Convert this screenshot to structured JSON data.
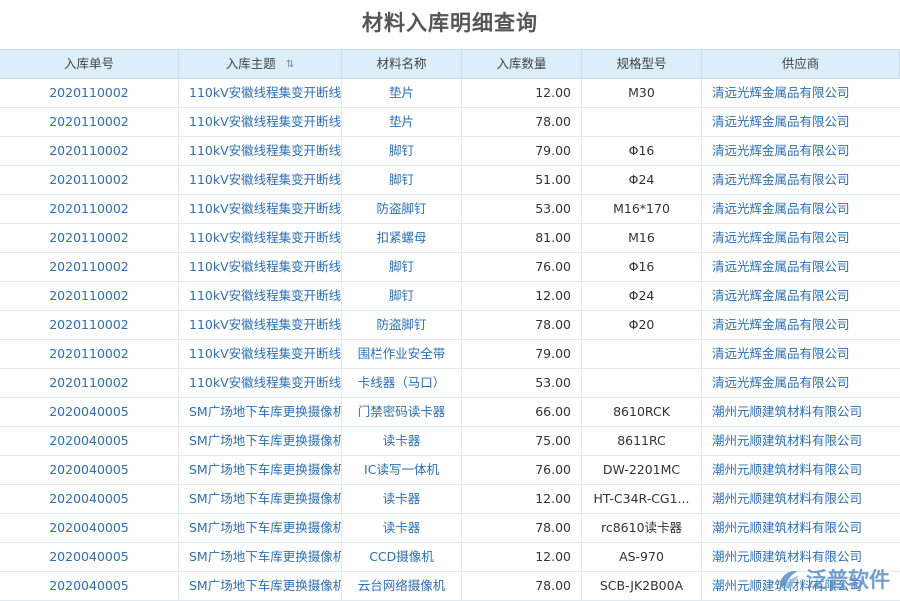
{
  "title": "材料入库明细查询",
  "columns": [
    "入库单号",
    "入库主题",
    "材料名称",
    "入库数量",
    "规格型号",
    "供应商"
  ],
  "rows": [
    [
      "2020110002",
      "110kV安徽线程集变开断线",
      "垫片",
      "12.00",
      "M30",
      "清远光辉金属品有限公司"
    ],
    [
      "2020110002",
      "110kV安徽线程集变开断线",
      "垫片",
      "78.00",
      "",
      "清远光辉金属品有限公司"
    ],
    [
      "2020110002",
      "110kV安徽线程集变开断线",
      "脚钉",
      "79.00",
      "Φ16",
      "清远光辉金属品有限公司"
    ],
    [
      "2020110002",
      "110kV安徽线程集变开断线",
      "脚钉",
      "51.00",
      "Φ24",
      "清远光辉金属品有限公司"
    ],
    [
      "2020110002",
      "110kV安徽线程集变开断线",
      "防盗脚钉",
      "53.00",
      "M16*170",
      "清远光辉金属品有限公司"
    ],
    [
      "2020110002",
      "110kV安徽线程集变开断线",
      "扣紧螺母",
      "81.00",
      "M16",
      "清远光辉金属品有限公司"
    ],
    [
      "2020110002",
      "110kV安徽线程集变开断线",
      "脚钉",
      "76.00",
      "Φ16",
      "清远光辉金属品有限公司"
    ],
    [
      "2020110002",
      "110kV安徽线程集变开断线",
      "脚钉",
      "12.00",
      "Φ24",
      "清远光辉金属品有限公司"
    ],
    [
      "2020110002",
      "110kV安徽线程集变开断线",
      "防盗脚钉",
      "78.00",
      "Φ20",
      "清远光辉金属品有限公司"
    ],
    [
      "2020110002",
      "110kV安徽线程集变开断线",
      "围栏作业安全带",
      "79.00",
      "",
      "清远光辉金属品有限公司"
    ],
    [
      "2020110002",
      "110kV安徽线程集变开断线",
      "卡线器（马口）",
      "53.00",
      "",
      "清远光辉金属品有限公司"
    ],
    [
      "2020040005",
      "SM广场地下车库更换摄像机",
      "门禁密码读卡器",
      "66.00",
      "8610RCK",
      "潮州元顺建筑材料有限公司"
    ],
    [
      "2020040005",
      "SM广场地下车库更换摄像机",
      "读卡器",
      "75.00",
      "8611RC",
      "潮州元顺建筑材料有限公司"
    ],
    [
      "2020040005",
      "SM广场地下车库更换摄像机",
      "IC读写一体机",
      "76.00",
      "DW-2201MC",
      "潮州元顺建筑材料有限公司"
    ],
    [
      "2020040005",
      "SM广场地下车库更换摄像机",
      "读卡器",
      "12.00",
      "HT-C34R-CG1...",
      "潮州元顺建筑材料有限公司"
    ],
    [
      "2020040005",
      "SM广场地下车库更换摄像机",
      "读卡器",
      "78.00",
      "rc8610读卡器",
      "潮州元顺建筑材料有限公司"
    ],
    [
      "2020040005",
      "SM广场地下车库更换摄像机",
      "CCD摄像机",
      "12.00",
      "AS-970",
      "潮州元顺建筑材料有限公司"
    ],
    [
      "2020040005",
      "SM广场地下车库更换摄像机",
      "云台网络摄像机",
      "78.00",
      "SCB-JK2B00A",
      "潮州元顺建筑材料有限公司"
    ]
  ],
  "watermark": "泛普软件",
  "icons": {
    "sort": "sort-icon",
    "watermark_logo": "fanpu-logo-icon"
  },
  "colors": {
    "header_bg": "#dceefa",
    "link": "#2d6fb2",
    "watermark": "#5a8fc4"
  }
}
